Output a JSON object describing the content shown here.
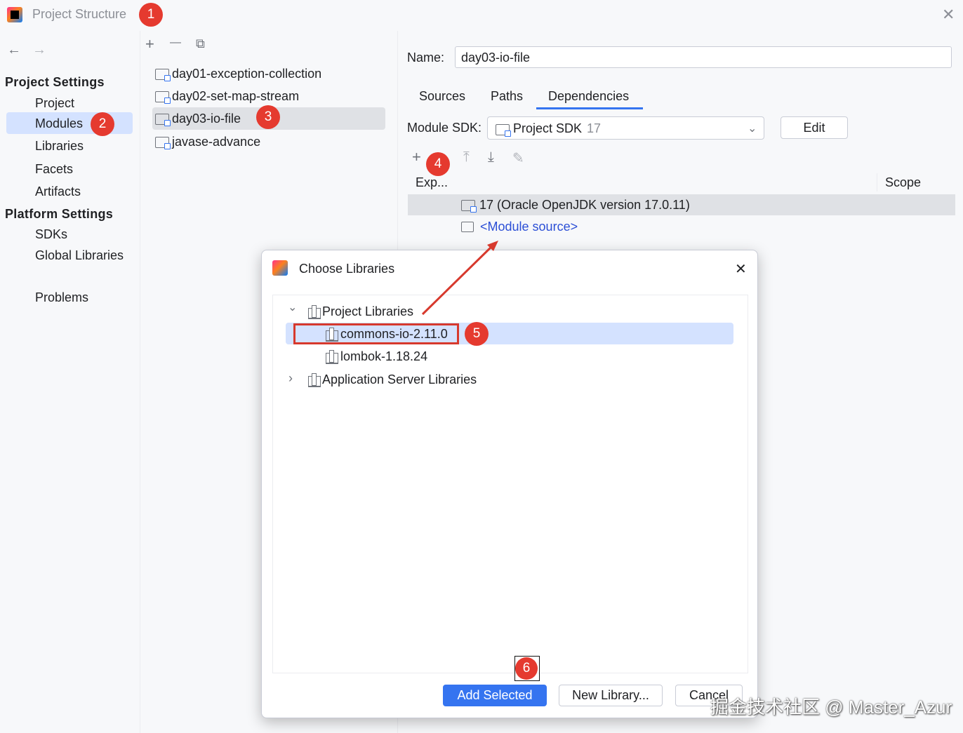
{
  "window": {
    "title": "Project Structure",
    "close_glyph": "✕"
  },
  "nav": {
    "back_glyph": "←",
    "forward_glyph": "→",
    "project_settings_header": "Project Settings",
    "project_settings_items": [
      "Project",
      "Modules",
      "Libraries",
      "Facets",
      "Artifacts"
    ],
    "platform_settings_header": "Platform Settings",
    "platform_settings_items": [
      "SDKs",
      "Global Libraries"
    ],
    "problems": "Problems",
    "selected_item": "Modules"
  },
  "modules": {
    "toolbar": {
      "add_glyph": "+",
      "remove_glyph": "—",
      "copy_glyph": "⧉"
    },
    "items": [
      "day01-exception-collection",
      "day02-set-map-stream",
      "day03-io-file",
      "javase-advance"
    ],
    "selected": "day03-io-file"
  },
  "details": {
    "name_label": "Name:",
    "name_value": "day03-io-file",
    "tabs": [
      "Sources",
      "Paths",
      "Dependencies"
    ],
    "active_tab": "Dependencies",
    "module_sdk_label": "Module SDK:",
    "module_sdk_value": "Project SDK",
    "module_sdk_version": "17",
    "edit_label": "Edit",
    "dep_toolbar": {
      "add_glyph": "+",
      "up_glyph": "⤒",
      "down_glyph": "⤓",
      "edit_glyph": "✎"
    },
    "columns": {
      "export": "Exp...",
      "scope": "Scope"
    },
    "rows": [
      "17 (Oracle OpenJDK version 17.0.11)",
      "<Module source>"
    ]
  },
  "dialog": {
    "title": "Choose Libraries",
    "close_glyph": "✕",
    "tree": {
      "project_libraries": "Project Libraries",
      "items": [
        "commons-io-2.11.0",
        "lombok-1.18.24"
      ],
      "app_server_libraries": "Application Server Libraries",
      "selected": "commons-io-2.11.0",
      "expand_open": "⌄",
      "expand_closed": "›"
    },
    "buttons": {
      "add_selected": "Add Selected",
      "new_library": "New Library...",
      "cancel": "Cancel"
    }
  },
  "annotations": {
    "badges": [
      "1",
      "2",
      "3",
      "4",
      "5",
      "6"
    ],
    "arrow_color": "#d7392d"
  },
  "watermark": "掘金技术社区 @ Master_Azur",
  "colors": {
    "accent": "#3574f0",
    "selection": "#d4e2ff",
    "badge": "#e53a2f",
    "link": "#2c4fd6"
  }
}
